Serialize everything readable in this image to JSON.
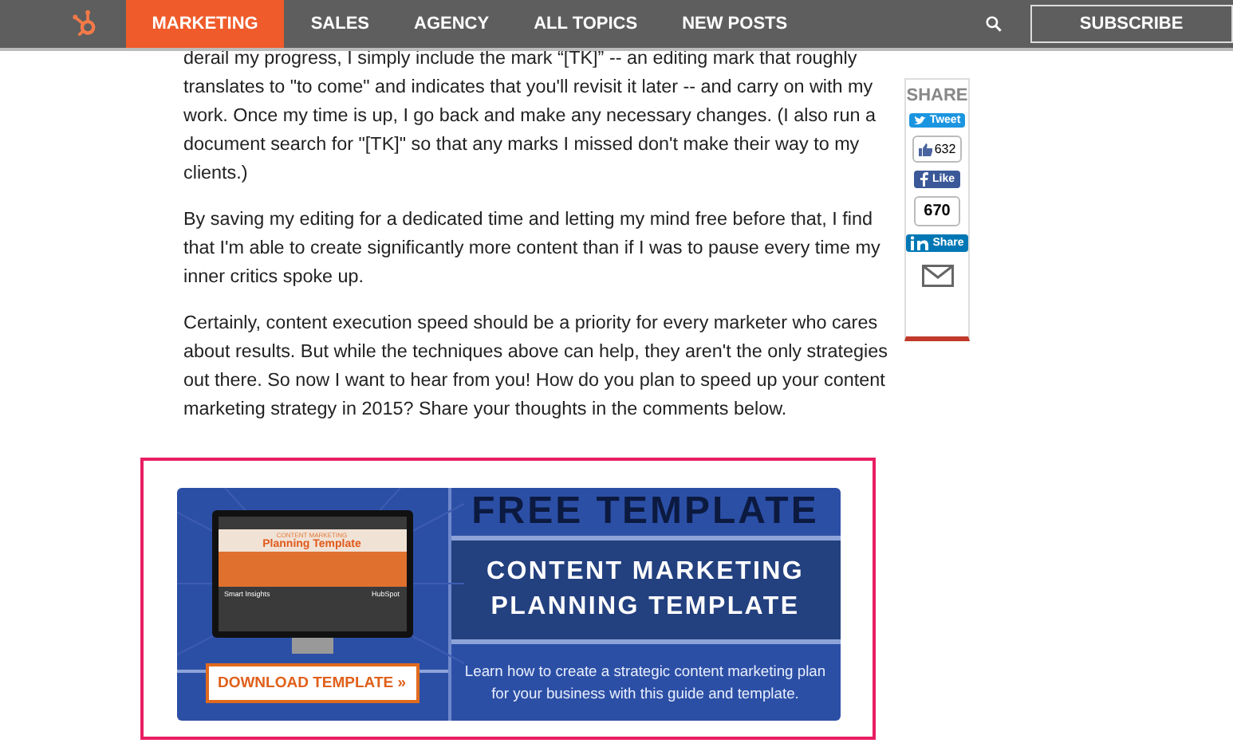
{
  "nav": {
    "items": [
      {
        "label": "MARKETING",
        "selected": true
      },
      {
        "label": "SALES",
        "selected": false
      },
      {
        "label": "AGENCY",
        "selected": false
      },
      {
        "label": "ALL TOPICS",
        "selected": false
      },
      {
        "label": "NEW POSTS",
        "selected": false
      }
    ],
    "subscribe": "SUBSCRIBE"
  },
  "article": {
    "paragraphs": [
      "derail my progress, I simply include the mark “[TK]” -- an editing mark that roughly translates to \"to come\" and indicates that you'll revisit it later -- and carry on with my work. Once my time is up, I go back and make any necessary changes. (I also run a document search for \"[TK]\" so that any marks I missed don't make their way to my clients.)",
      "By saving my editing for a dedicated time and letting my mind free before that, I find that I'm able to create significantly more content than if I was to pause every time my inner critics spoke up.",
      "Certainly, content execution speed should be a priority for every marketer who cares about results. But while the techniques above can help, they aren't the only strategies out there. So now I want to hear from you! How do you plan to speed up your content marketing strategy in 2015? Share your thoughts in the comments below."
    ]
  },
  "share": {
    "title": "SHARE",
    "tweet": "Tweet",
    "like_count": "632",
    "like": "Like",
    "linkedin_count": "670",
    "linkedin": "Share"
  },
  "banner": {
    "screen_kicker": "CONTENT MARKETING",
    "screen_title": "Planning Template",
    "screen_brand_left": "Smart Insights",
    "screen_brand_right": "HubSpot",
    "download": "DOWNLOAD TEMPLATE »",
    "kicker": "FREE TEMPLATE",
    "title": "CONTENT MARKETING PLANNING TEMPLATE",
    "description": "Learn how to create a strategic content marketing plan for your business with this guide and template."
  }
}
